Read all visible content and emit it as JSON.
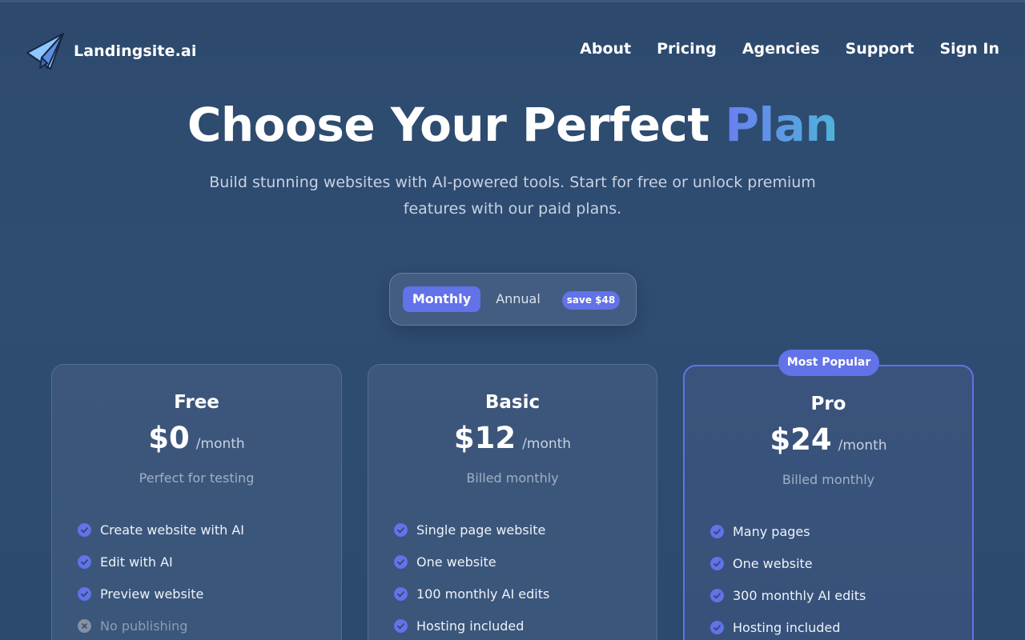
{
  "brand": {
    "name": "Landingsite.ai"
  },
  "nav": {
    "items": [
      {
        "label": "About"
      },
      {
        "label": "Pricing"
      },
      {
        "label": "Agencies"
      },
      {
        "label": "Support"
      },
      {
        "label": "Sign In"
      }
    ]
  },
  "hero": {
    "title_main": "Choose Your Perfect ",
    "title_accent": "Plan",
    "subtitle": "Build stunning websites with AI-powered tools. Start for free or unlock premium features with our paid plans."
  },
  "billing_toggle": {
    "monthly_label": "Monthly",
    "annual_label": "Annual",
    "save_badge": "save $48",
    "selected": "Monthly"
  },
  "plans": [
    {
      "name": "Free",
      "price": "$0",
      "period": "/month",
      "note": "Perfect for testing",
      "features": [
        {
          "label": "Create website with AI",
          "included": true
        },
        {
          "label": "Edit with AI",
          "included": true
        },
        {
          "label": "Preview website",
          "included": true
        },
        {
          "label": "No publishing",
          "included": false
        }
      ]
    },
    {
      "name": "Basic",
      "price": "$12",
      "period": "/month",
      "note": "Billed monthly",
      "features": [
        {
          "label": "Single page website",
          "included": true
        },
        {
          "label": "One website",
          "included": true
        },
        {
          "label": "100 monthly AI edits",
          "included": true
        },
        {
          "label": "Hosting included",
          "included": true
        }
      ]
    },
    {
      "name": "Pro",
      "badge": "Most Popular",
      "price": "$24",
      "period": "/month",
      "note": "Billed monthly",
      "features": [
        {
          "label": "Many pages",
          "included": true
        },
        {
          "label": "One website",
          "included": true
        },
        {
          "label": "300 monthly AI edits",
          "included": true
        },
        {
          "label": "Hosting included",
          "included": true
        }
      ]
    }
  ],
  "colors": {
    "accent": "#6272e8",
    "background": "#2d4a6e",
    "title_gradient_start": "#6a7ff0",
    "title_gradient_end": "#4fb3d9"
  },
  "icons": {
    "logo": "paper-plane-icon",
    "feature_included": "check-circle-icon",
    "feature_excluded": "x-circle-icon"
  }
}
